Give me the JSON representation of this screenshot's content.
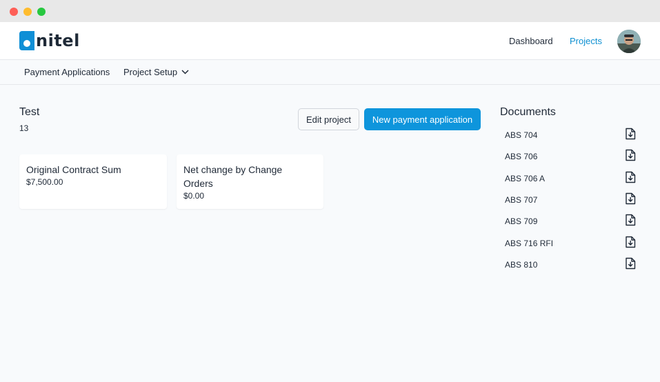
{
  "header": {
    "logo_text": "nitel",
    "nav": {
      "dashboard": "Dashboard",
      "projects": "Projects"
    }
  },
  "subnav": {
    "payment_applications": "Payment Applications",
    "project_setup": "Project Setup"
  },
  "project": {
    "title": "Test",
    "number": "13",
    "edit_button": "Edit project",
    "new_payment_button": "New payment application"
  },
  "cards": [
    {
      "label": "Original Contract Sum",
      "value": "$7,500.00"
    },
    {
      "label": "Net change by Change Orders",
      "value": "$0.00"
    }
  ],
  "documents": {
    "title": "Documents",
    "items": [
      {
        "name": "ABS 704",
        "icon": "file-download-icon"
      },
      {
        "name": "ABS 706",
        "icon": "file-download-icon"
      },
      {
        "name": "ABS 706 A",
        "icon": "file-download-icon"
      },
      {
        "name": "ABS 707",
        "icon": "file-download-icon"
      },
      {
        "name": "ABS 709",
        "icon": "file-download-icon"
      },
      {
        "name": "ABS 716 RFI",
        "icon": "file-download-icon"
      },
      {
        "name": "ABS 810",
        "icon": "file-download-icon"
      }
    ]
  },
  "colors": {
    "accent": "#0e95dc",
    "brand": "#0f8fd6",
    "background": "#f8fafc"
  }
}
